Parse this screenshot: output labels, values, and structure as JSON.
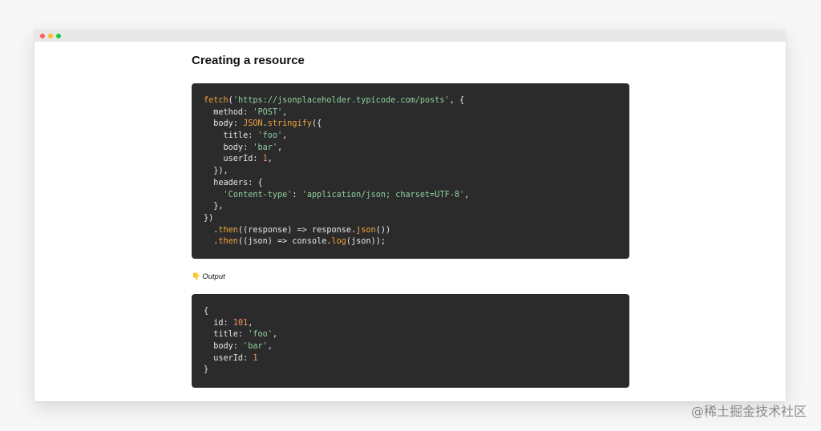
{
  "window": {
    "controls": [
      "close",
      "minimize",
      "maximize"
    ]
  },
  "page": {
    "heading": "Creating a resource",
    "output_icon": "pointing-down-hand-icon",
    "output_label": "Output"
  },
  "code_request": {
    "lines": [
      [
        {
          "t": "fn",
          "v": "fetch"
        },
        {
          "t": "plain",
          "v": "("
        },
        {
          "t": "str",
          "v": "'https://jsonplaceholder.typicode.com/posts'"
        },
        {
          "t": "plain",
          "v": ", {"
        }
      ],
      [
        {
          "t": "plain",
          "v": "  method: "
        },
        {
          "t": "str",
          "v": "'POST'"
        },
        {
          "t": "plain",
          "v": ","
        }
      ],
      [
        {
          "t": "plain",
          "v": "  body: "
        },
        {
          "t": "fn",
          "v": "JSON"
        },
        {
          "t": "plain",
          "v": "."
        },
        {
          "t": "fn",
          "v": "stringify"
        },
        {
          "t": "plain",
          "v": "({"
        }
      ],
      [
        {
          "t": "plain",
          "v": "    title: "
        },
        {
          "t": "str",
          "v": "'foo'"
        },
        {
          "t": "plain",
          "v": ","
        }
      ],
      [
        {
          "t": "plain",
          "v": "    body: "
        },
        {
          "t": "str",
          "v": "'bar'"
        },
        {
          "t": "plain",
          "v": ","
        }
      ],
      [
        {
          "t": "plain",
          "v": "    userId: "
        },
        {
          "t": "num",
          "v": "1"
        },
        {
          "t": "plain",
          "v": ","
        }
      ],
      [
        {
          "t": "plain",
          "v": "  }),"
        }
      ],
      [
        {
          "t": "plain",
          "v": "  headers: {"
        }
      ],
      [
        {
          "t": "plain",
          "v": "    "
        },
        {
          "t": "str",
          "v": "'Content-type'"
        },
        {
          "t": "plain",
          "v": ": "
        },
        {
          "t": "str",
          "v": "'application/json; charset=UTF-8'"
        },
        {
          "t": "plain",
          "v": ","
        }
      ],
      [
        {
          "t": "plain",
          "v": "  },"
        }
      ],
      [
        {
          "t": "plain",
          "v": "})"
        }
      ],
      [
        {
          "t": "plain",
          "v": "  ."
        },
        {
          "t": "fn",
          "v": "then"
        },
        {
          "t": "plain",
          "v": "((response) => response."
        },
        {
          "t": "fn",
          "v": "json"
        },
        {
          "t": "plain",
          "v": "())"
        }
      ],
      [
        {
          "t": "plain",
          "v": "  ."
        },
        {
          "t": "fn",
          "v": "then"
        },
        {
          "t": "plain",
          "v": "((json) => console."
        },
        {
          "t": "fn",
          "v": "log"
        },
        {
          "t": "plain",
          "v": "(json));"
        }
      ]
    ]
  },
  "code_output": {
    "lines": [
      [
        {
          "t": "plain",
          "v": "{"
        }
      ],
      [
        {
          "t": "plain",
          "v": "  id: "
        },
        {
          "t": "num",
          "v": "101"
        },
        {
          "t": "plain",
          "v": ","
        }
      ],
      [
        {
          "t": "plain",
          "v": "  title: "
        },
        {
          "t": "str",
          "v": "'foo'"
        },
        {
          "t": "plain",
          "v": ","
        }
      ],
      [
        {
          "t": "plain",
          "v": "  body: "
        },
        {
          "t": "str",
          "v": "'bar'"
        },
        {
          "t": "plain",
          "v": ","
        }
      ],
      [
        {
          "t": "plain",
          "v": "  userId: "
        },
        {
          "t": "num",
          "v": "1"
        }
      ],
      [
        {
          "t": "plain",
          "v": "}"
        }
      ]
    ]
  },
  "watermark": "@稀土掘金技术社区",
  "colors": {
    "code_bg": "#2b2b2b",
    "function": "#f0a340",
    "string": "#8fd19e",
    "number": "#f5926a",
    "plain": "#e6e6e6"
  }
}
